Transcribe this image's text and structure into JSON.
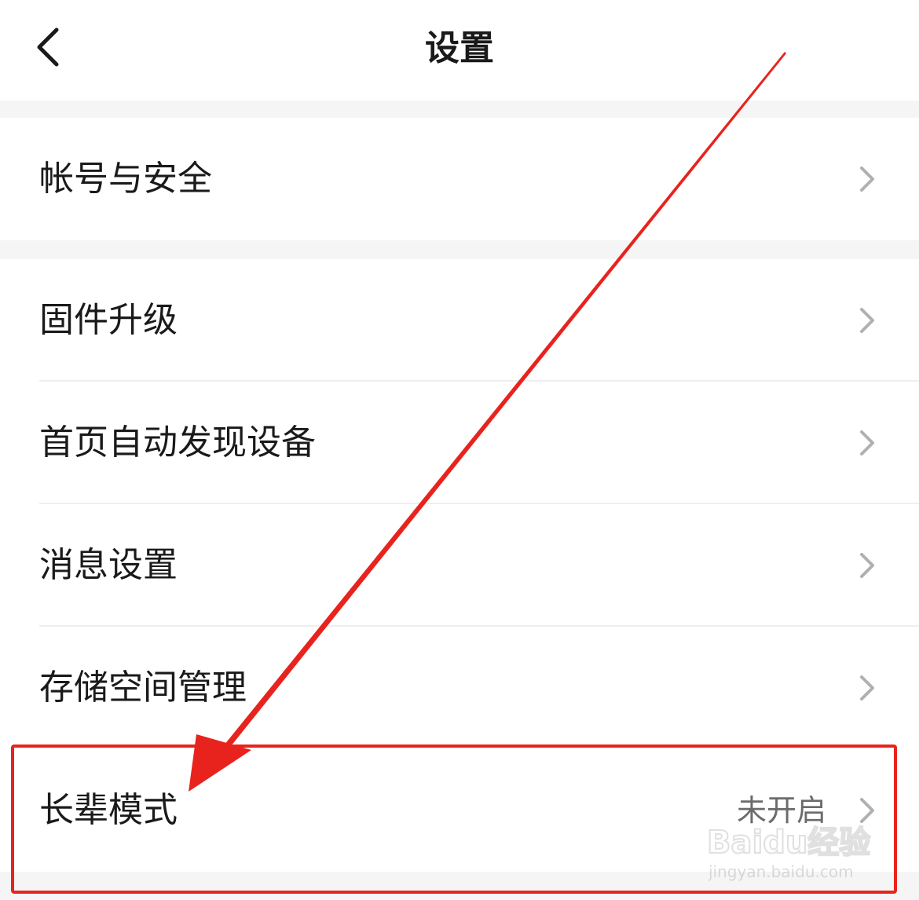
{
  "header": {
    "title": "设置",
    "back_icon": "chevron-left-icon"
  },
  "groups": [
    {
      "items": [
        {
          "label": "帐号与安全",
          "value": ""
        }
      ]
    },
    {
      "items": [
        {
          "label": "固件升级",
          "value": ""
        },
        {
          "label": "首页自动发现设备",
          "value": ""
        },
        {
          "label": "消息设置",
          "value": ""
        },
        {
          "label": "存储空间管理",
          "value": ""
        },
        {
          "label": "长辈模式",
          "value": "未开启"
        }
      ]
    }
  ],
  "watermark": {
    "brand": "Baidu经验",
    "url": "jingyan.baidu.com"
  },
  "colors": {
    "background": "#f5f5f5",
    "card": "#ffffff",
    "text_primary": "#1a1a1a",
    "text_secondary": "#6b6b6b",
    "chevron": "#b0b0b0",
    "annotation": "#e8231e"
  }
}
